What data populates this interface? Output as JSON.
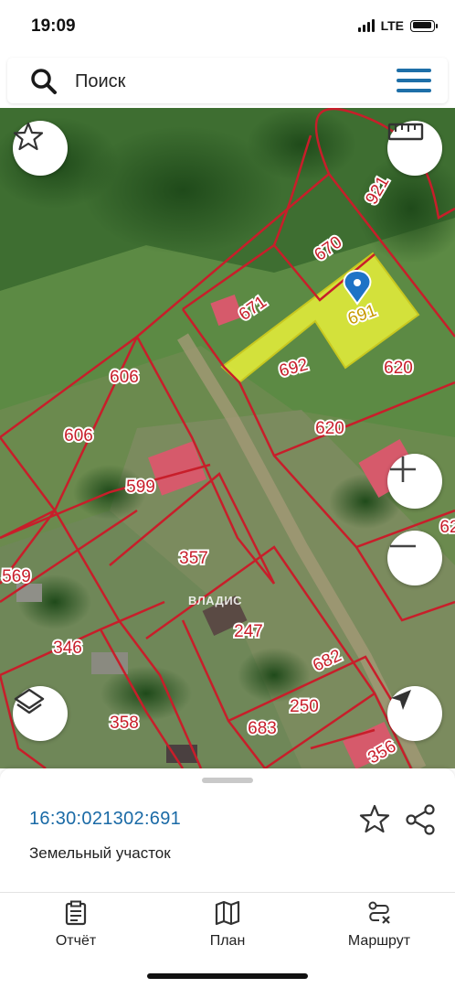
{
  "status_bar": {
    "time": "19:09",
    "network": "LTE",
    "battery_level": 0.8
  },
  "search": {
    "label": "Поиск",
    "icon": "search-icon",
    "menu_icon": "menu-icon"
  },
  "map": {
    "watermark": "ВЛАДИС",
    "selected_parcel": "691",
    "parcel_labels": [
      "921",
      "670",
      "671",
      "691",
      "692",
      "620",
      "620",
      "606",
      "606",
      "599",
      "357",
      "569",
      "346",
      "247",
      "682",
      "250",
      "683",
      "358",
      "356",
      "62"
    ],
    "colors": {
      "boundary": "#c81e2a",
      "selected_fill": "#e8f03a",
      "marker": "#1e73c6"
    },
    "controls": {
      "favorites_icon": "star-outline-icon",
      "ruler_icon": "ruler-icon",
      "zoom_in_icon": "plus-icon",
      "zoom_out_icon": "minus-icon",
      "layers_icon": "layers-icon",
      "location_icon": "navigation-arrow-icon"
    }
  },
  "sheet": {
    "cadastral_number": "16:30:021302:691",
    "object_type": "Земельный участок",
    "favorite_icon": "star-outline-icon",
    "share_icon": "share-icon"
  },
  "nav": {
    "items": [
      {
        "label": "Отчёт",
        "icon": "report-icon"
      },
      {
        "label": "План",
        "icon": "map-plan-icon"
      },
      {
        "label": "Маршрут",
        "icon": "route-icon"
      }
    ]
  }
}
